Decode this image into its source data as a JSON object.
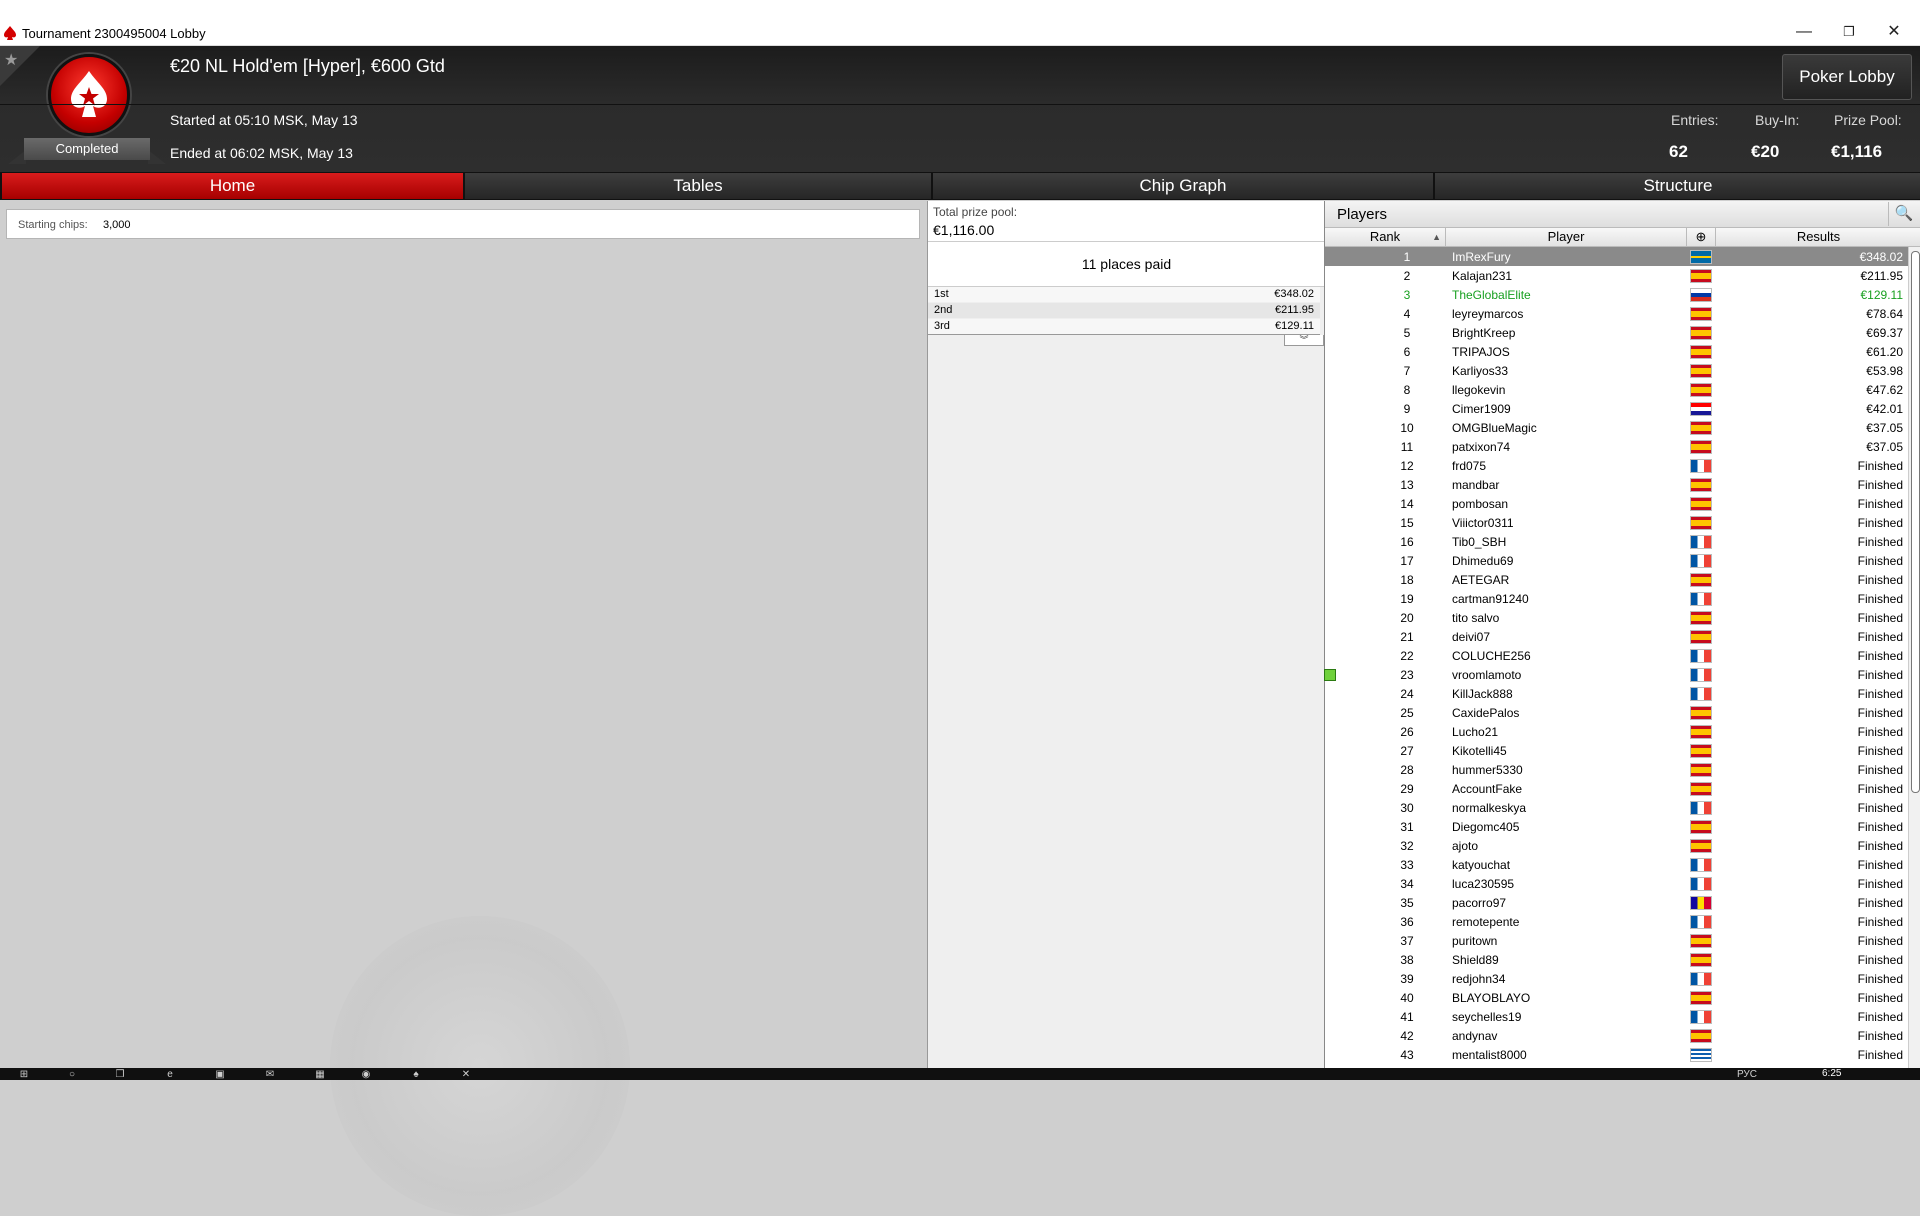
{
  "window": {
    "title": "Tournament 2300495004 Lobby",
    "minimize": "—",
    "restore": "❐",
    "close": "✕"
  },
  "tournament": {
    "name": "€20 NL Hold'em [Hyper], €600 Gtd",
    "status": "Completed",
    "started": "Started at 05:10 MSK, May 13",
    "ended": "Ended at 06:02 MSK, May 13",
    "poker_lobby_label": "Poker Lobby"
  },
  "stats": {
    "entries_label": "Entries:",
    "entries_value": "62",
    "buyin_label": "Buy-In:",
    "buyin_value": "€20",
    "prizepool_label": "Prize Pool:",
    "prizepool_value": "€1,116"
  },
  "tabs": [
    {
      "label": "Home",
      "active": true
    },
    {
      "label": "Tables",
      "active": false
    },
    {
      "label": "Chip Graph",
      "active": false
    },
    {
      "label": "Structure",
      "active": false
    }
  ],
  "home": {
    "starting_chips_label": "Starting chips:",
    "starting_chips_value": "3,000"
  },
  "prize": {
    "total_label": "Total prize pool:",
    "total_value": "€1,116.00",
    "places_paid": "11 places paid",
    "payouts": [
      {
        "place": "1st",
        "amount": "€348.02"
      },
      {
        "place": "2nd",
        "amount": "€211.95"
      },
      {
        "place": "3rd",
        "amount": "€129.11"
      }
    ]
  },
  "players": {
    "title": "Players",
    "columns": {
      "rank": "Rank",
      "player": "Player",
      "results": "Results"
    },
    "rows": [
      {
        "rank": "1",
        "name": "ImRexFury",
        "flag": "se",
        "result": "€348.02",
        "selected": true
      },
      {
        "rank": "2",
        "name": "Kalajan231",
        "flag": "es",
        "result": "€211.95"
      },
      {
        "rank": "3",
        "name": "TheGlobalElite",
        "flag": "ru",
        "result": "€129.11",
        "highlight": true
      },
      {
        "rank": "4",
        "name": "leyreymarcos",
        "flag": "es",
        "result": "€78.64"
      },
      {
        "rank": "5",
        "name": "BrightKreep",
        "flag": "es",
        "result": "€69.37"
      },
      {
        "rank": "6",
        "name": "TRIPAJOS",
        "flag": "es",
        "result": "€61.20"
      },
      {
        "rank": "7",
        "name": "Karliyos33",
        "flag": "es",
        "result": "€53.98"
      },
      {
        "rank": "8",
        "name": "llegokevin",
        "flag": "es",
        "result": "€47.62"
      },
      {
        "rank": "9",
        "name": "Cimer1909",
        "flag": "hr",
        "result": "€42.01"
      },
      {
        "rank": "10",
        "name": "OMGBlueMagic",
        "flag": "es",
        "result": "€37.05"
      },
      {
        "rank": "11",
        "name": "patxixon74",
        "flag": "es",
        "result": "€37.05"
      },
      {
        "rank": "12",
        "name": "frd075",
        "flag": "fr",
        "result": "Finished"
      },
      {
        "rank": "13",
        "name": "mandbar",
        "flag": "es",
        "result": "Finished"
      },
      {
        "rank": "14",
        "name": "pombosan",
        "flag": "es",
        "result": "Finished"
      },
      {
        "rank": "15",
        "name": "Viiictor0311",
        "flag": "es",
        "result": "Finished"
      },
      {
        "rank": "16",
        "name": "Tib0_SBH",
        "flag": "fr",
        "result": "Finished"
      },
      {
        "rank": "17",
        "name": "Dhimedu69",
        "flag": "fr",
        "result": "Finished"
      },
      {
        "rank": "18",
        "name": "AETEGAR",
        "flag": "es",
        "result": "Finished"
      },
      {
        "rank": "19",
        "name": "cartman91240",
        "flag": "fr",
        "result": "Finished"
      },
      {
        "rank": "20",
        "name": "tito salvo",
        "flag": "es",
        "result": "Finished"
      },
      {
        "rank": "21",
        "name": "deivi07",
        "flag": "es",
        "result": "Finished"
      },
      {
        "rank": "22",
        "name": "COLUCHE256",
        "flag": "fr",
        "result": "Finished"
      },
      {
        "rank": "23",
        "name": "vroomlamoto",
        "flag": "fr",
        "result": "Finished",
        "marker": true
      },
      {
        "rank": "24",
        "name": "KillJack888",
        "flag": "fr",
        "result": "Finished"
      },
      {
        "rank": "25",
        "name": "CaxidePalos",
        "flag": "es",
        "result": "Finished"
      },
      {
        "rank": "26",
        "name": "Lucho21",
        "flag": "es",
        "result": "Finished"
      },
      {
        "rank": "27",
        "name": "Kikotelli45",
        "flag": "es",
        "result": "Finished"
      },
      {
        "rank": "28",
        "name": "hummer5330",
        "flag": "es",
        "result": "Finished"
      },
      {
        "rank": "29",
        "name": "AccountFake",
        "flag": "es",
        "result": "Finished"
      },
      {
        "rank": "30",
        "name": "normalkeskya",
        "flag": "fr",
        "result": "Finished"
      },
      {
        "rank": "31",
        "name": "Diegomc405",
        "flag": "es",
        "result": "Finished"
      },
      {
        "rank": "32",
        "name": "ajoto",
        "flag": "es",
        "result": "Finished"
      },
      {
        "rank": "33",
        "name": "katyouchat",
        "flag": "fr",
        "result": "Finished"
      },
      {
        "rank": "34",
        "name": "luca230595",
        "flag": "fr",
        "result": "Finished"
      },
      {
        "rank": "35",
        "name": "pacorro97",
        "flag": "ad",
        "result": "Finished"
      },
      {
        "rank": "36",
        "name": "remotepente",
        "flag": "fr",
        "result": "Finished"
      },
      {
        "rank": "37",
        "name": "puritown",
        "flag": "es",
        "result": "Finished"
      },
      {
        "rank": "38",
        "name": "Shield89",
        "flag": "es",
        "result": "Finished"
      },
      {
        "rank": "39",
        "name": "redjohn34",
        "flag": "fr",
        "result": "Finished"
      },
      {
        "rank": "40",
        "name": "BLAYOBLAYO",
        "flag": "es",
        "result": "Finished"
      },
      {
        "rank": "41",
        "name": "seychelles19",
        "flag": "fr",
        "result": "Finished"
      },
      {
        "rank": "42",
        "name": "andynav",
        "flag": "es",
        "result": "Finished"
      },
      {
        "rank": "43",
        "name": "mentalist8000",
        "flag": "gr",
        "result": "Finished"
      }
    ]
  },
  "taskbar": {
    "clock": "6:25",
    "lang": "РУС",
    "icons": [
      "windows-icon",
      "search-icon",
      "task-view-icon",
      "edge-icon",
      "store-icon",
      "mail-icon",
      "calculator-icon",
      "chrome-icon",
      "pokerstars-icon",
      "xbox-icon"
    ]
  },
  "colors": {
    "accent_red": "#d91c1c",
    "highlight_green": "#18a020",
    "selected_row": "#8a8a8a"
  }
}
